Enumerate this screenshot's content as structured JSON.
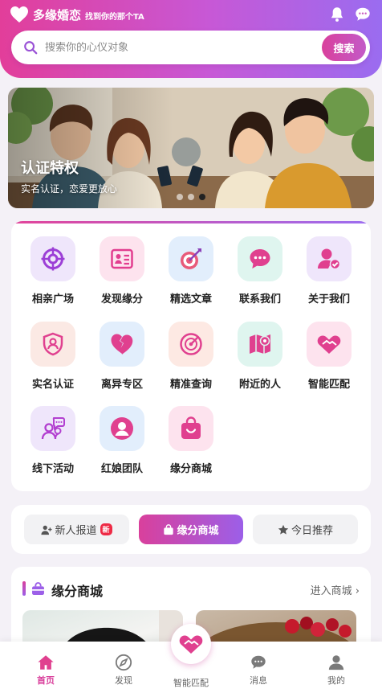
{
  "header": {
    "app_name": "多缘婚恋",
    "slogan": "找到你的那个TA",
    "icons": [
      "bell-icon",
      "chat-icon"
    ]
  },
  "search": {
    "placeholder": "搜索你的心仪对象",
    "button_label": "搜索"
  },
  "banner": {
    "title": "认证特权",
    "subtitle": "实名认证，恋爱更放心",
    "slide_count": 3,
    "active_slide": 3
  },
  "menu": {
    "items": [
      {
        "label": "相亲广场",
        "icon": "target-icon",
        "color": "#9c3fd6"
      },
      {
        "label": "发现缘分",
        "icon": "profile-card-icon",
        "color": "#e23d8f"
      },
      {
        "label": "精选文章",
        "icon": "dart-icon",
        "color": "#e85a7a"
      },
      {
        "label": "联系我们",
        "icon": "chat-bubble-icon",
        "color": "#e0408f"
      },
      {
        "label": "关于我们",
        "icon": "user-check-icon",
        "color": "#e0408f"
      },
      {
        "label": "实名认证",
        "icon": "shield-user-icon",
        "color": "#e0408f"
      },
      {
        "label": "离异专区",
        "icon": "broken-heart-icon",
        "color": "#e0408f"
      },
      {
        "label": "精准查询",
        "icon": "radar-icon",
        "color": "#e0408f"
      },
      {
        "label": "附近的人",
        "icon": "map-pin-icon",
        "color": "#e0408f"
      },
      {
        "label": "智能匹配",
        "icon": "handshake-heart-icon",
        "color": "#e0408f"
      },
      {
        "label": "线下活动",
        "icon": "group-chat-icon",
        "color": "#b23fd0"
      },
      {
        "label": "红娘团队",
        "icon": "person-circle-icon",
        "color": "#e0408f"
      },
      {
        "label": "缘分商城",
        "icon": "shopping-bag-icon",
        "color": "#e0408f"
      }
    ]
  },
  "tabs": [
    {
      "label": "新人报道",
      "icon": "user-plus-icon",
      "badge": "新"
    },
    {
      "label": "缘分商城",
      "icon": "shop-icon",
      "active": true
    },
    {
      "label": "今日推荐",
      "icon": "star-icon"
    }
  ],
  "shop": {
    "title": "缘分商城",
    "more_label": "进入商城"
  },
  "bottom_nav": [
    {
      "label": "首页",
      "icon": "home-icon",
      "active": true
    },
    {
      "label": "发现",
      "icon": "compass-icon"
    },
    {
      "label": "智能匹配",
      "icon": "handshake-heart-icon"
    },
    {
      "label": "消息",
      "icon": "message-icon"
    },
    {
      "label": "我的",
      "icon": "user-icon"
    }
  ]
}
